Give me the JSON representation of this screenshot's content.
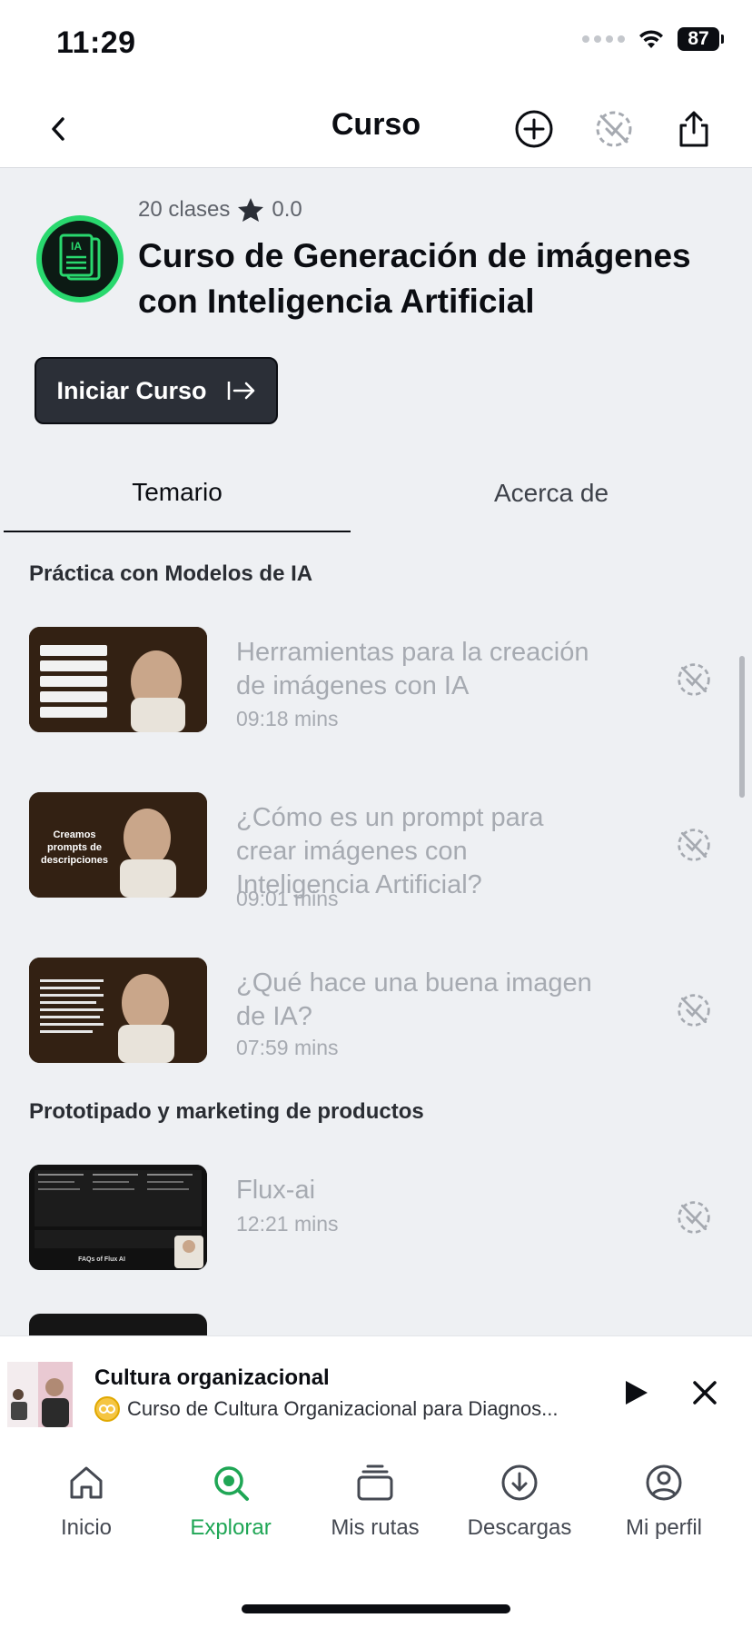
{
  "status_bar": {
    "time": "11:29",
    "battery": "87"
  },
  "nav": {
    "title": "Curso"
  },
  "course": {
    "classes": "20 clases",
    "rating": "0.0",
    "title": "Curso de Generación de imágenes con Inteligencia Artificial",
    "badge": "IA",
    "start_label": "Iniciar Curso"
  },
  "tabs": {
    "temario": "Temario",
    "acerca": "Acerca de"
  },
  "sections": [
    {
      "title": "Práctica con Modelos de IA",
      "lessons": [
        {
          "title": "Herramientas para la creación de imágenes con IA",
          "duration": "09:18 mins"
        },
        {
          "title": "¿Cómo es un prompt para crear imágenes con Inteligencia Artificial?",
          "duration": "09:01 mins",
          "thumb_text": "Creamos prompts de descripciones"
        },
        {
          "title": "¿Qué hace una buena imagen de IA?",
          "duration": "07:59 mins"
        }
      ]
    },
    {
      "title": "Prototipado y marketing de productos",
      "lessons": [
        {
          "title": "Flux-ai",
          "duration": "12:21 mins",
          "thumb_text": "FAQs of Flux AI"
        }
      ]
    }
  ],
  "mini_player": {
    "title": "Cultura organizacional",
    "subtitle": "Curso de Cultura Organizacional para Diagnos..."
  },
  "tabbar": [
    {
      "label": "Inicio",
      "icon": "home-icon"
    },
    {
      "label": "Explorar",
      "icon": "explore-icon",
      "active": true
    },
    {
      "label": "Mis rutas",
      "icon": "stack-icon"
    },
    {
      "label": "Descargas",
      "icon": "download-icon"
    },
    {
      "label": "Mi perfil",
      "icon": "profile-icon"
    }
  ],
  "colors": {
    "accent": "#1fa655",
    "badge_ring": "#29d86e",
    "button_bg": "#2b2f37",
    "muted_text": "#a6aab1"
  }
}
